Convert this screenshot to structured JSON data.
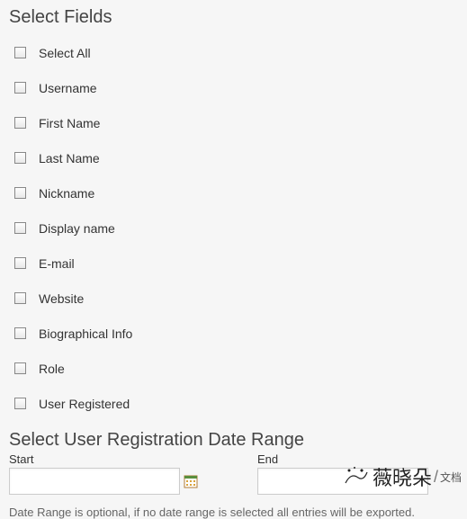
{
  "fields_section": {
    "heading": "Select Fields",
    "items": [
      {
        "label": "Select All"
      },
      {
        "label": "Username"
      },
      {
        "label": "First Name"
      },
      {
        "label": "Last Name"
      },
      {
        "label": "Nickname"
      },
      {
        "label": "Display name"
      },
      {
        "label": "E-mail"
      },
      {
        "label": "Website"
      },
      {
        "label": "Biographical Info"
      },
      {
        "label": "Role"
      },
      {
        "label": "User Registered"
      }
    ]
  },
  "date_section": {
    "heading": "Select User Registration Date Range",
    "start_label": "Start",
    "end_label": "End",
    "start_value": "",
    "end_value": "",
    "note": "Date Range is optional, if no date range is selected all entries will be exported."
  },
  "watermark": {
    "brand": "薇晓朵",
    "sub": "文档"
  }
}
